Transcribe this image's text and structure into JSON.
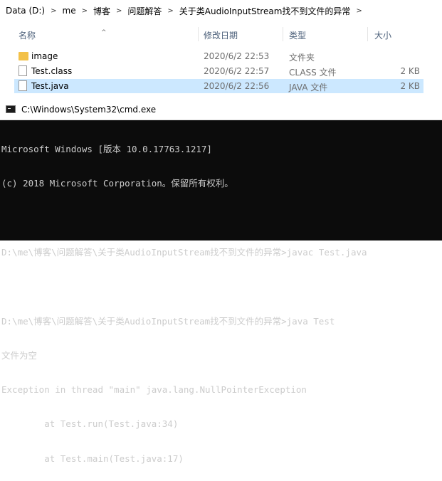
{
  "explorer": {
    "breadcrumb": [
      "Data (D:)",
      "me",
      "博客",
      "问题解答",
      "关于类AudioInputStream找不到文件的异常"
    ],
    "columns": {
      "name": "名称",
      "date": "修改日期",
      "type": "类型",
      "size": "大小"
    },
    "files": [
      {
        "name": "image",
        "date": "2020/6/2 22:53",
        "type": "文件夹",
        "size": "",
        "icon": "folder-icon"
      },
      {
        "name": "Test.class",
        "date": "2020/6/2 22:57",
        "type": "CLASS 文件",
        "size": "2 KB",
        "icon": "file-icon"
      },
      {
        "name": "Test.java",
        "date": "2020/6/2 22:56",
        "type": "JAVA 文件",
        "size": "2 KB",
        "icon": "file-icon",
        "selected": true
      }
    ]
  },
  "cmd": {
    "title": "C:\\Windows\\System32\\cmd.exe",
    "lines": [
      "Microsoft Windows [版本 10.0.17763.1217]",
      "(c) 2018 Microsoft Corporation。保留所有权利。",
      "",
      "D:\\me\\博客\\问题解答\\关于类AudioInputStream找不到文件的异常>javac Test.java",
      "",
      "D:\\me\\博客\\问题解答\\关于类AudioInputStream找不到文件的异常>java Test",
      "文件为空",
      "Exception in thread \"main\" java.lang.NullPointerException",
      "        at Test.run(Test.java:34)",
      "        at Test.main(Test.java:17)"
    ]
  }
}
